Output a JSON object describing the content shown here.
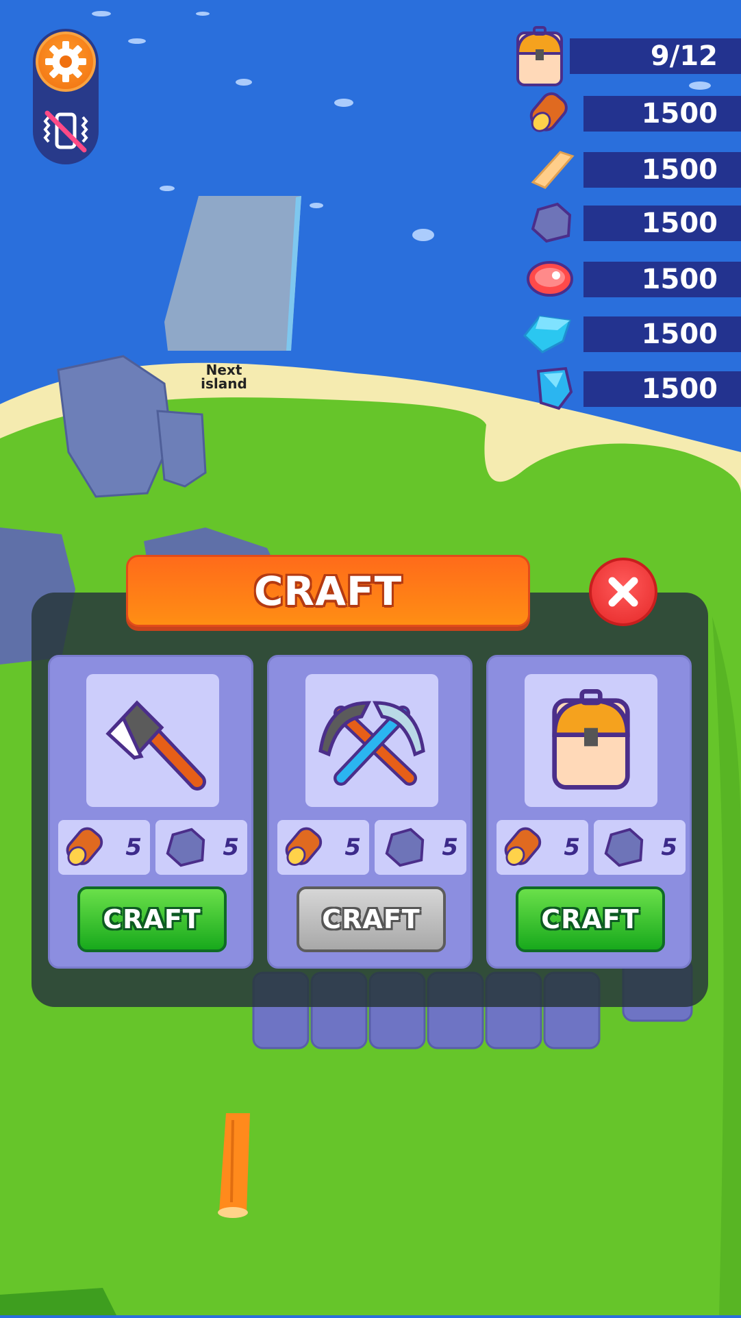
{
  "hud": {
    "capacity": "9/12",
    "resources": [
      {
        "name": "log",
        "amount": "1500"
      },
      {
        "name": "plank",
        "amount": "1500"
      },
      {
        "name": "stone",
        "amount": "1500"
      },
      {
        "name": "meat",
        "amount": "1500"
      },
      {
        "name": "crystal",
        "amount": "1500"
      },
      {
        "name": "gem",
        "amount": "1500"
      }
    ]
  },
  "world": {
    "next_island_label": "Next island"
  },
  "modal": {
    "title": "CRAFT",
    "cards": [
      {
        "item": "axe-icon",
        "costs": [
          {
            "resource": "log",
            "amount": "5"
          },
          {
            "resource": "stone",
            "amount": "5"
          }
        ],
        "button": "CRAFT",
        "enabled": true
      },
      {
        "item": "pickaxe-icon",
        "costs": [
          {
            "resource": "log",
            "amount": "5"
          },
          {
            "resource": "stone",
            "amount": "5"
          }
        ],
        "button": "CRAFT",
        "enabled": false
      },
      {
        "item": "backpack-icon",
        "costs": [
          {
            "resource": "log",
            "amount": "5"
          },
          {
            "resource": "stone",
            "amount": "5"
          }
        ],
        "button": "CRAFT",
        "enabled": true
      }
    ]
  },
  "colors": {
    "water": "#2a6fdc",
    "grass": "#66c52a",
    "sand": "#f5ebb0",
    "accent_orange": "#ff7a18",
    "close_red": "#e52828",
    "button_green": "#18a91c"
  }
}
